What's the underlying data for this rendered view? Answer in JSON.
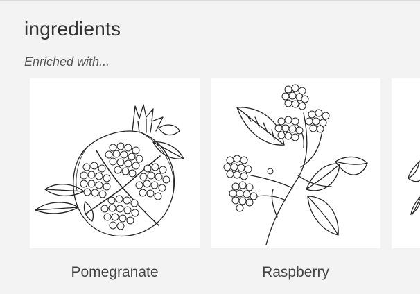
{
  "section": {
    "title": "ingredients",
    "subtitle": "Enriched with..."
  },
  "ingredients": [
    {
      "name": "Pomegranate",
      "icon": "pomegranate-illustration"
    },
    {
      "name": "Raspberry",
      "icon": "raspberry-illustration"
    },
    {
      "name": "",
      "icon": "partial-leaf-illustration"
    }
  ]
}
